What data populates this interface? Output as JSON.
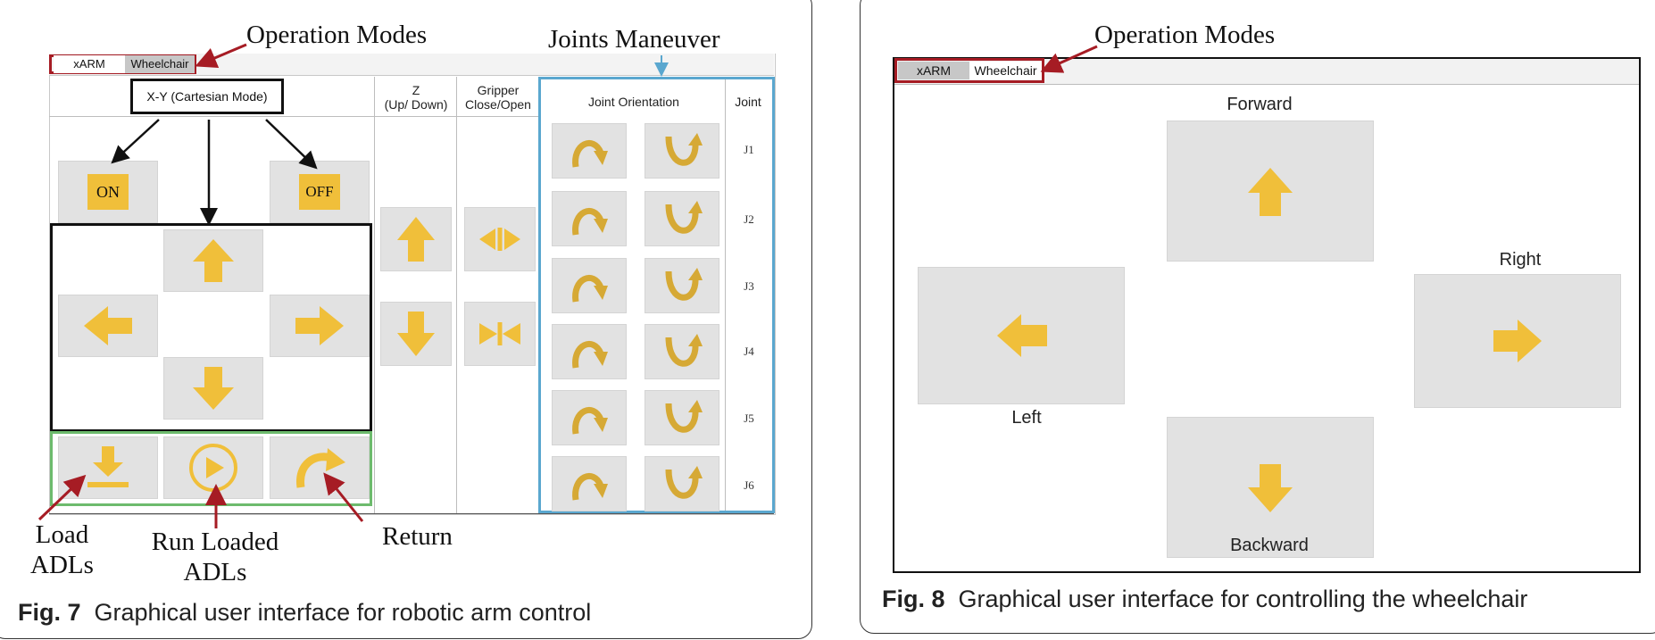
{
  "fig7": {
    "annotations": {
      "operation_modes": "Operation Modes",
      "joints_maneuver": "Joints Maneuver",
      "load_line1": "Load",
      "load_line2": "ADLs",
      "run_line1": "Run Loaded",
      "run_line2": "ADLs",
      "return": "Return"
    },
    "tabs": [
      "xARM",
      "Wheelchair"
    ],
    "mode_box": "X-Y (Cartesian Mode)",
    "headers": {
      "z_line1": "Z",
      "z_line2": "(Up/ Down)",
      "gripper_line1": "Gripper",
      "gripper_line2": "Close/Open",
      "joint_orientation": "Joint Orientation",
      "joint": "Joint"
    },
    "buttons": {
      "on": "ON",
      "off": "OFF"
    },
    "joints": [
      "J1",
      "J2",
      "J3",
      "J4",
      "J5",
      "J6"
    ],
    "caption_label": "Fig. 7",
    "caption_text": "Graphical user interface for robotic arm control"
  },
  "fig8": {
    "annotations": {
      "operation_modes": "Operation Modes"
    },
    "tabs": [
      "xARM",
      "Wheelchair"
    ],
    "labels": {
      "forward": "Forward",
      "left": "Left",
      "right": "Right",
      "backward": "Backward"
    },
    "caption_label": "Fig. 8",
    "caption_text": "Graphical user interface for controlling the wheelchair"
  },
  "colors": {
    "icon": "#f0bf3a",
    "button_bg": "#e2e2e2",
    "highlight_red": "#a61c24",
    "joints_blue": "#5aa7cf",
    "adl_green": "#6dbb6d",
    "frame_black": "#111111"
  },
  "icons": [
    "arrow-up-icon",
    "arrow-down-icon",
    "arrow-left-icon",
    "arrow-right-icon",
    "load-icon",
    "play-icon",
    "return-icon",
    "rotate-cw-icon",
    "rotate-ccw-icon",
    "gripper-open-icon",
    "gripper-close-icon"
  ]
}
